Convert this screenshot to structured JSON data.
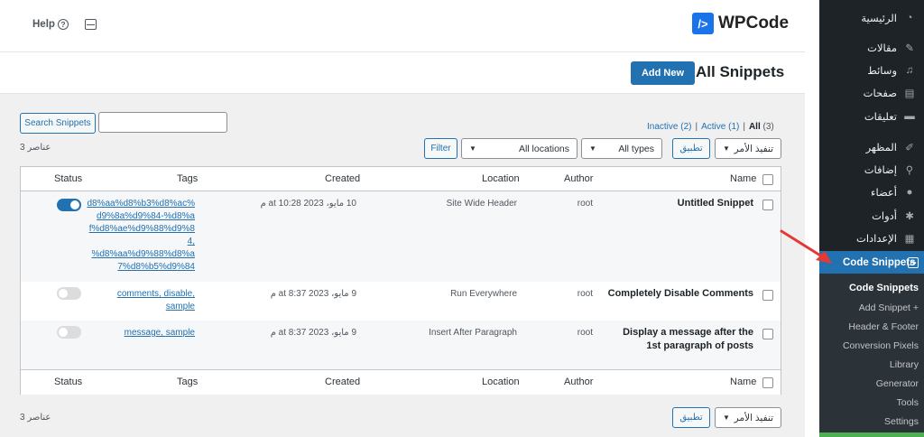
{
  "colors": {
    "accent": "#2271b1",
    "sidebar_bg": "#1d2327",
    "submenu_bg": "#2c3338",
    "annotation_arrow": "#e53935"
  },
  "topbar": {
    "help_label": "Help",
    "help_glyph": "?",
    "logo_mark": "/>",
    "logo_text": "WPCode"
  },
  "header": {
    "title": "All Snippets",
    "add_new_label": "Add New"
  },
  "views": {
    "inactive": "Inactive",
    "inactive_count": "(2)",
    "active": "Active",
    "active_count": "(1)",
    "all": "All",
    "all_count": "(3)",
    "separator": "|"
  },
  "search": {
    "value": "",
    "button_label": "Search Snippets"
  },
  "bulk": {
    "top_select": "تنفيذ الأمر",
    "top_apply": "تطبيق",
    "bottom_select": "تنفيذ الأمر",
    "bottom_apply": "تطبيق"
  },
  "filters": {
    "types": "All types",
    "locations": "All locations",
    "filter_label": "Filter"
  },
  "items_count": "3 عناصر",
  "table": {
    "columns": {
      "name": "Name",
      "author": "Author",
      "location": "Location",
      "created": "Created",
      "tags": "Tags",
      "status": "Status"
    },
    "rows": [
      {
        "name_line1": "Untitled Snippet",
        "name_line2": "",
        "author": "root",
        "location": "Site Wide Header",
        "created": "10 مايو، 2023 at 10:28 م",
        "tags": [
          "d8%aa%d8%b3%d8%ac%d9%8a%d9%84-%d8%af%d8%ae%d9%88%d9%84,",
          "%d8%aa%d9%88%d8%a7%d8%b5%d9%84"
        ],
        "active": true
      },
      {
        "name_line1": "Completely Disable Comments",
        "name_line2": "",
        "author": "root",
        "location": "Run Everywhere",
        "created": "9 مايو، 2023 at 8:37 م",
        "tags": [
          "comments,",
          "disable,",
          "sample"
        ],
        "active": false
      },
      {
        "name_line1": "Display a message after the",
        "name_line2": "1st paragraph of posts",
        "author": "root",
        "location": "Insert After Paragraph",
        "created": "9 مايو، 2023 at 8:37 م",
        "tags": [
          "message,",
          "sample"
        ],
        "active": false
      }
    ]
  },
  "sidebar": {
    "items": [
      {
        "label": "الرئيسية",
        "icon": "dashboard-icon",
        "glyph": "◔"
      },
      {
        "label": "مقالات",
        "icon": "pin-icon",
        "glyph": "✎"
      },
      {
        "label": "وسائط",
        "icon": "media-icon",
        "glyph": "♫"
      },
      {
        "label": "صفحات",
        "icon": "pages-icon",
        "glyph": "▤"
      },
      {
        "label": "تعليقات",
        "icon": "comments-icon",
        "glyph": "▬"
      },
      {
        "label": "المظهر",
        "icon": "appearance-icon",
        "glyph": "✐"
      },
      {
        "label": "إضافات",
        "icon": "plugins-icon",
        "glyph": "⚲"
      },
      {
        "label": "أعضاء",
        "icon": "users-icon",
        "glyph": "●"
      },
      {
        "label": "أدوات",
        "icon": "tools-icon",
        "glyph": "✱"
      },
      {
        "label": "الإعدادات",
        "icon": "settings-icon",
        "glyph": "▦"
      },
      {
        "label": "Code Snippets",
        "icon": "code-icon",
        "glyph": "/>"
      }
    ],
    "submenu": [
      "Code Snippets",
      "Add Snippet +",
      "Header & Footer",
      "Conversion Pixels",
      "Library",
      "Generator",
      "Tools",
      "Settings"
    ]
  }
}
